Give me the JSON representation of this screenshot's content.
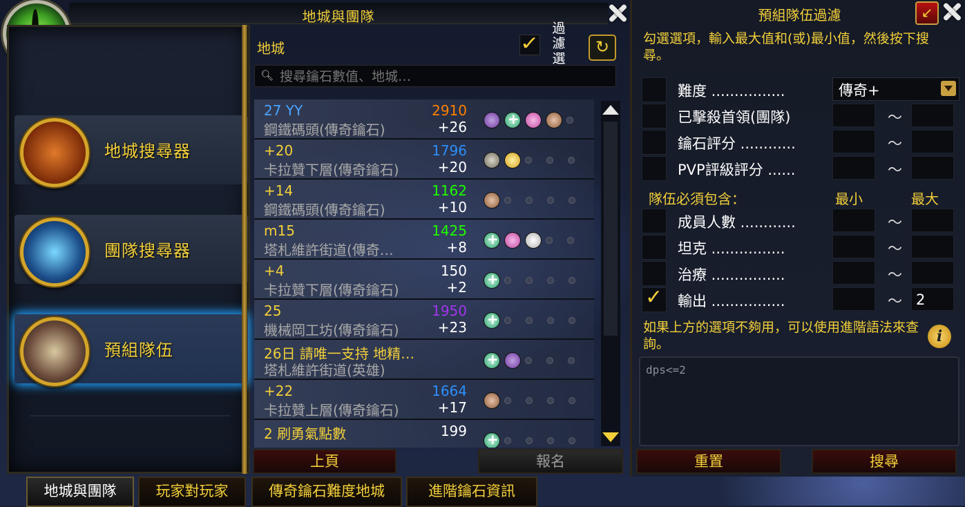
{
  "window": {
    "title": "地城與團隊"
  },
  "left_nav": [
    {
      "label": "地城搜尋器",
      "icon": "dungeon-helm-icon"
    },
    {
      "label": "團隊搜尋器",
      "icon": "raid-helm-icon"
    },
    {
      "label": "預組隊伍",
      "icon": "premade-group-icon"
    }
  ],
  "list_panel": {
    "category": "地城",
    "filter_label": "過濾選項",
    "search_placeholder": "搜尋鑰石數值、地城…",
    "rows": [
      {
        "title": "27  YY",
        "subtitle": "鋼鐵碼頭(傳奇鑰石)",
        "score": "2910",
        "score_color": "#ff8000",
        "gain": "+26",
        "title_color": "#4aa3ff",
        "roles": [
          "tp",
          "h",
          "dp",
          "d"
        ]
      },
      {
        "title": "+20",
        "subtitle": "卡拉贊下層(傳奇鑰石)",
        "score": "1796",
        "score_color": "#2c8fff",
        "gain": "+20",
        "title_color": "#f2cf3a",
        "roles": [
          "t",
          "dy"
        ]
      },
      {
        "title": "+14",
        "subtitle": "鋼鐵碼頭(傳奇鑰石)",
        "score": "1162",
        "score_color": "#1eff00",
        "gain": "+10",
        "title_color": "#f2cf3a",
        "roles": [
          "d"
        ]
      },
      {
        "title": "m15",
        "subtitle": "塔札維許街道(傳奇…",
        "score": "1425",
        "score_color": "#1eff00",
        "gain": "+8",
        "title_color": "#f2cf3a",
        "roles": [
          "h",
          "dp",
          "dw"
        ]
      },
      {
        "title": "+4",
        "subtitle": "卡拉贊下層(傳奇鑰石)",
        "score": "150",
        "score_color": "#ffffff",
        "gain": "+2",
        "title_color": "#f2cf3a",
        "roles": [
          "h"
        ]
      },
      {
        "title": "25",
        "subtitle": "機械岡工坊(傳奇鑰石)",
        "score": "1950",
        "score_color": "#a335ee",
        "gain": "+23",
        "title_color": "#f2cf3a",
        "roles": [
          "h"
        ]
      },
      {
        "title": "26日 請唯一支持 地精…",
        "subtitle": "塔札維許街道(英雄)",
        "score": "",
        "score_color": "#ffffff",
        "gain": "",
        "title_color": "#f2cf3a",
        "roles": [
          "h",
          "tp"
        ]
      },
      {
        "title": "+22",
        "subtitle": "卡拉贊上層(傳奇鑰石)",
        "score": "1664",
        "score_color": "#2c8fff",
        "gain": "+17",
        "title_color": "#f2cf3a",
        "roles": [
          "d"
        ]
      },
      {
        "title": "2 刷勇氣點數",
        "subtitle": "",
        "score": "199",
        "score_color": "#ffffff",
        "gain": "",
        "title_color": "#f2cf3a",
        "roles": [
          "h"
        ]
      }
    ],
    "back_label": "上頁",
    "signup_label": "報名"
  },
  "bottom_tabs": [
    "地城與團隊",
    "玩家對玩家",
    "傳奇鑰石難度地城",
    "進階鑰石資訊"
  ],
  "filter_panel": {
    "title": "預組隊伍過濾",
    "description": "勾選選項，輸入最大值和(或)最小值，然後按下搜尋。",
    "difficulty_label": "難度 ................",
    "difficulty_value": "傳奇+",
    "rows": [
      {
        "label": "已擊殺首領(團隊)",
        "min": "",
        "max": ""
      },
      {
        "label": "鑰石評分 ............",
        "min": "",
        "max": ""
      },
      {
        "label": "PVP評級評分 ......",
        "min": "",
        "max": ""
      }
    ],
    "must_include_label": "隊伍必須包含：",
    "min_header": "最小",
    "max_header": "最大",
    "role_rows": [
      {
        "label": "成員人數 ............",
        "checked": false,
        "min": "",
        "max": ""
      },
      {
        "label": "坦克 ................",
        "checked": false,
        "min": "",
        "max": ""
      },
      {
        "label": "治療 ................",
        "checked": false,
        "min": "",
        "max": ""
      },
      {
        "label": "輸出 ................",
        "checked": true,
        "min": "",
        "max": "2"
      }
    ],
    "tilde": "～",
    "advanced_hint": "如果上方的選項不夠用，可以使用進階語法來查詢。",
    "query_text": "dps<=2",
    "reset_label": "重置",
    "search_label": "搜尋"
  }
}
